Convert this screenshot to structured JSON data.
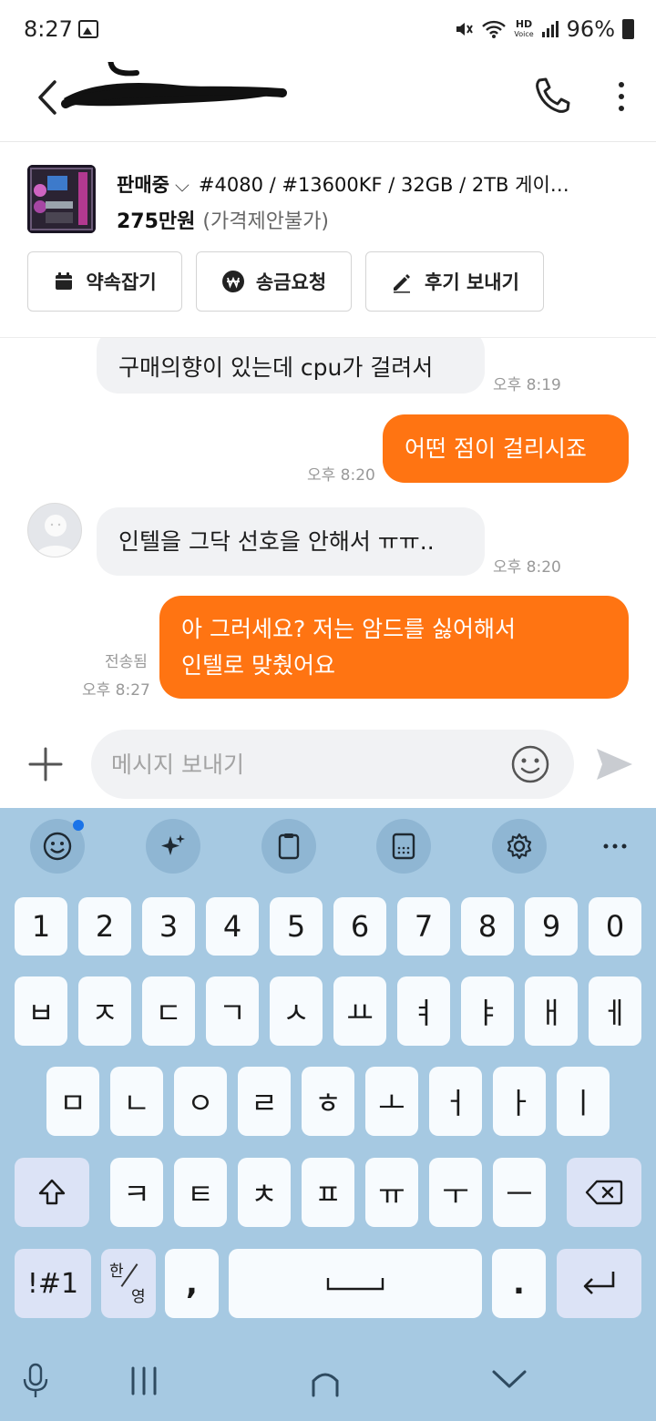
{
  "status_bar": {
    "time": "8:27",
    "battery": "96%",
    "hd_line1": "HD",
    "hd_line2": "Voice"
  },
  "header": {
    "contact_name_redacted": true
  },
  "product": {
    "state": "판매중",
    "title": "#4080 / #13600KF / 32GB / 2TB 게이…",
    "price": "275만원",
    "price_note": "(가격제안불가)",
    "buttons": [
      {
        "label": "약속잡기",
        "icon": "calendar-icon"
      },
      {
        "label": "송금요청",
        "icon": "won-icon"
      },
      {
        "label": "후기 보내기",
        "icon": "pencil-icon"
      }
    ]
  },
  "messages": [
    {
      "side": "in",
      "text": "구매의향이 있는데 cpu가 걸려서",
      "time": "오후 8:19"
    },
    {
      "side": "out",
      "text": "어떤 점이 걸리시죠",
      "time": "오후 8:20"
    },
    {
      "side": "in",
      "text": "인텔을 그닥 선호을 안해서 ㅠㅠ..",
      "time": "오후 8:20"
    },
    {
      "side": "out",
      "line1": "아 그러세요? 저는 암드를 싫어해서",
      "line2": "인텔로 맞췄어요",
      "status": "전송됨",
      "time": "오후 8:27"
    }
  ],
  "input": {
    "placeholder": "메시지 보내기"
  },
  "keyboard": {
    "toolbar": [
      "emoji-icon",
      "sparkle-icon",
      "clipboard-icon",
      "keypad-icon",
      "gear-icon",
      "more-icon"
    ],
    "numbers": [
      "1",
      "2",
      "3",
      "4",
      "5",
      "6",
      "7",
      "8",
      "9",
      "0"
    ],
    "row1": [
      "ㅂ",
      "ㅈ",
      "ㄷ",
      "ㄱ",
      "ㅅ",
      "ㅛ",
      "ㅕ",
      "ㅑ",
      "ㅐ",
      "ㅔ"
    ],
    "row2": [
      "ㅁ",
      "ㄴ",
      "ㅇ",
      "ㄹ",
      "ㅎ",
      "ㅗ",
      "ㅓ",
      "ㅏ",
      "ㅣ"
    ],
    "row3": [
      "ㅋ",
      "ㅌ",
      "ㅊ",
      "ㅍ",
      "ㅠ",
      "ㅜ",
      "ㅡ"
    ],
    "symbols": "!#1",
    "lang_top": "한",
    "lang_bottom": "영",
    "comma": ",",
    "period": "."
  },
  "colors": {
    "accent": "#ff7412",
    "keyboard_bg": "#a6c9e2"
  }
}
